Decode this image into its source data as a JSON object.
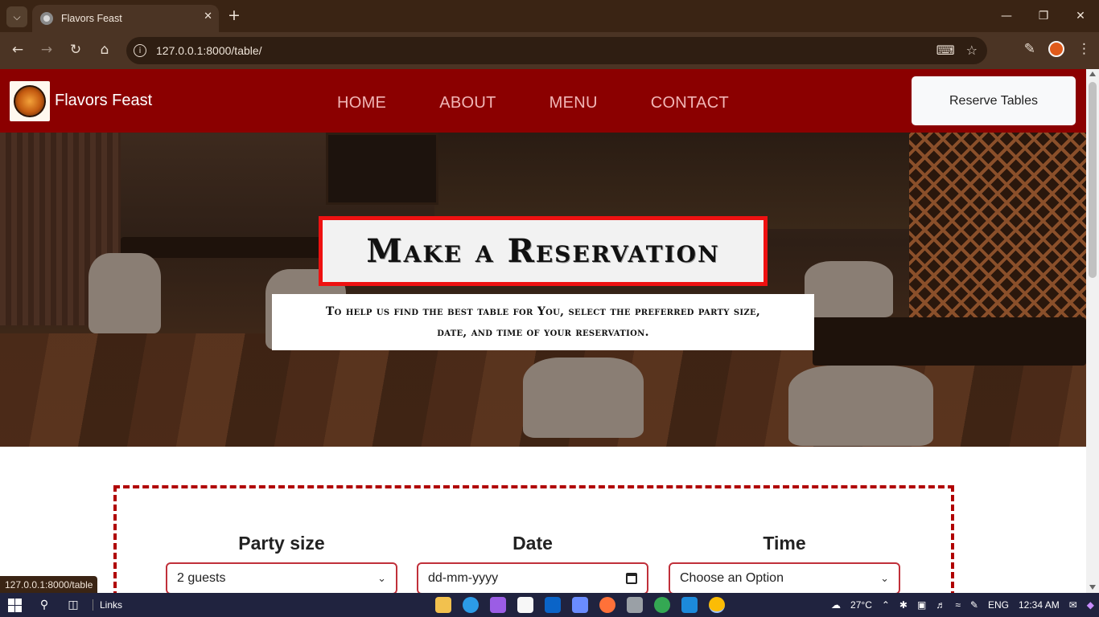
{
  "browser": {
    "tab_title": "Flavors Feast",
    "url": "127.0.0.1:8000/table/",
    "status_url": "127.0.0.1:8000/table"
  },
  "site": {
    "brand": "Flavors Feast",
    "nav": [
      {
        "label": "HOME"
      },
      {
        "label": "ABOUT"
      },
      {
        "label": "MENU"
      },
      {
        "label": "CONTACT"
      }
    ],
    "reserve_button": "Reserve Tables"
  },
  "hero": {
    "title": "Make a Reservation",
    "subtitle_line1": "To help us find the best table for You, select the preferred party size,",
    "subtitle_line2": "date, and time of your reservation."
  },
  "form": {
    "party_size": {
      "label": "Party size",
      "value": "2 guests"
    },
    "date": {
      "label": "Date",
      "placeholder": "dd-mm-yyyy"
    },
    "time": {
      "label": "Time",
      "value": "Choose an Option"
    }
  },
  "taskbar": {
    "links_label": "Links",
    "temperature": "27°C",
    "language": "ENG",
    "time": "12:34 AM"
  },
  "colors": {
    "nav_bg": "#8b0000",
    "accent_red": "#ee1111",
    "form_border": "#b00000"
  }
}
